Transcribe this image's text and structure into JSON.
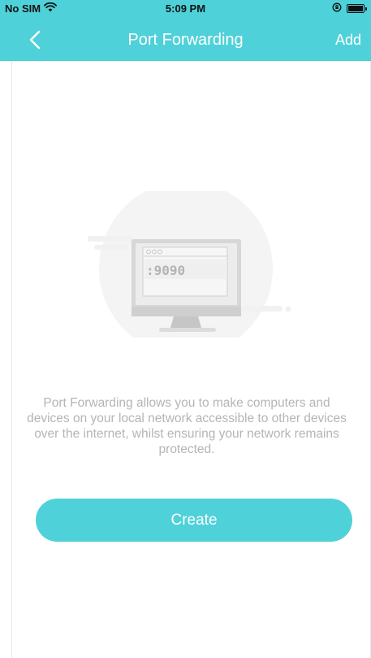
{
  "status_bar": {
    "carrier": "No SIM",
    "time": "5:09 PM",
    "icons": [
      "wifi-icon",
      "orientation-lock-icon",
      "battery-icon"
    ]
  },
  "nav": {
    "title": "Port Forwarding",
    "back_icon": "chevron-left-icon",
    "add_label": "Add"
  },
  "illustration": {
    "port_label": ":9090",
    "icon": "monitor-icon"
  },
  "description": "Port Forwarding allows you to make computers and devices on your local network accessible to other devices over the internet, whilst ensuring your network remains protected.",
  "create_button": {
    "label": "Create"
  },
  "colors": {
    "accent": "#4fd1d9",
    "description_text": "#b5b5b5",
    "white": "#ffffff"
  }
}
